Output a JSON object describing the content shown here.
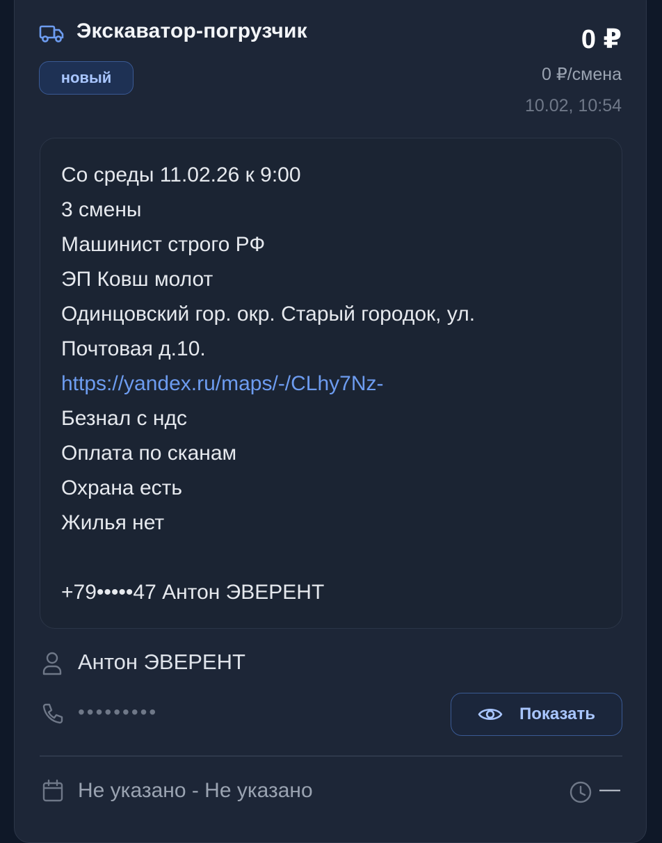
{
  "card": {
    "title": "Экскаватор-погрузчик",
    "badge": "новый",
    "price": "0 ₽",
    "price_per_shift": "0 ₽/смена",
    "posted_time": "10.02, 10:54",
    "description_lines": [
      "Со среды 11.02.26 к 9:00",
      "3 смены",
      "Машинист строго РФ",
      "ЭП Ковш молот",
      "Одинцовский гор. окр. Старый городок, ул.",
      "Почтовая д.10.",
      "https://yandex.ru/maps/-/CLhy7Nz-",
      "Безнал с ндс",
      "Оплата по сканам",
      "Охрана есть",
      "Жилья нет",
      "",
      "+79•••••47 Антон ЭВЕРЕНТ"
    ],
    "contact": {
      "name": "Антон ЭВЕРЕНТ",
      "phone_masked": "•••••••••",
      "show_label": "Показать"
    },
    "dates": {
      "range": "Не указано - Не указано",
      "time": "—"
    }
  },
  "icons": {
    "title": "truck-icon",
    "contact_name": "person-icon",
    "contact_phone": "phone-icon",
    "show_button": "eye-icon",
    "dates": "calendar-icon",
    "time": "clock-icon"
  },
  "colors": {
    "background": "#0f1828",
    "card": "#1d2637",
    "accent": "#a9c6ff",
    "link": "#6d9cf0",
    "badge_bg": "#1e3154"
  }
}
